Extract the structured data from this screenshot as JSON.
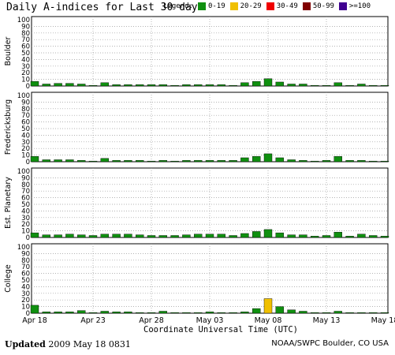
{
  "title": "Daily A-indices for Last 30 days",
  "legend": {
    "title": "Legend:",
    "items": [
      {
        "label": "0-19",
        "color": "#109010"
      },
      {
        "label": "20-29",
        "color": "#f0c000"
      },
      {
        "label": "30-49",
        "color": "#f00000"
      },
      {
        "label": "50-99",
        "color": "#800000"
      },
      {
        "label": ">=100",
        "color": "#400090"
      }
    ]
  },
  "footer": {
    "updated_label": "Updated",
    "updated_value": "2009 May 18 0831",
    "credit": "NOAA/SWPC Boulder, CO USA"
  },
  "chart_data": [
    {
      "type": "bar",
      "ylabel": "Boulder",
      "ylim": [
        0,
        100
      ],
      "yticks": [
        0,
        10,
        20,
        30,
        40,
        50,
        60,
        70,
        80,
        90,
        100
      ],
      "grid": true,
      "categories": [
        "Apr 18",
        "Apr 19",
        "Apr 20",
        "Apr 21",
        "Apr 22",
        "Apr 23",
        "Apr 24",
        "Apr 25",
        "Apr 26",
        "Apr 27",
        "Apr 28",
        "Apr 29",
        "Apr 30",
        "May 01",
        "May 02",
        "May 03",
        "May 04",
        "May 05",
        "May 06",
        "May 07",
        "May 08",
        "May 09",
        "May 10",
        "May 11",
        "May 12",
        "May 13",
        "May 14",
        "May 15",
        "May 16",
        "May 17",
        "May 18"
      ],
      "values": [
        7,
        3,
        4,
        4,
        3,
        1,
        5,
        2,
        2,
        2,
        2,
        2,
        1,
        2,
        2,
        2,
        2,
        1,
        5,
        7,
        11,
        6,
        3,
        3,
        1,
        1,
        5,
        1,
        3,
        1,
        1
      ]
    },
    {
      "type": "bar",
      "ylabel": "Fredericksburg",
      "ylim": [
        0,
        100
      ],
      "yticks": [
        0,
        10,
        20,
        30,
        40,
        50,
        60,
        70,
        80,
        90,
        100
      ],
      "grid": true,
      "categories": [
        "Apr 18",
        "Apr 19",
        "Apr 20",
        "Apr 21",
        "Apr 22",
        "Apr 23",
        "Apr 24",
        "Apr 25",
        "Apr 26",
        "Apr 27",
        "Apr 28",
        "Apr 29",
        "Apr 30",
        "May 01",
        "May 02",
        "May 03",
        "May 04",
        "May 05",
        "May 06",
        "May 07",
        "May 08",
        "May 09",
        "May 10",
        "May 11",
        "May 12",
        "May 13",
        "May 14",
        "May 15",
        "May 16",
        "May 17",
        "May 18"
      ],
      "values": [
        8,
        3,
        3,
        3,
        2,
        1,
        5,
        2,
        2,
        2,
        1,
        2,
        1,
        2,
        2,
        2,
        2,
        2,
        6,
        8,
        12,
        6,
        3,
        2,
        1,
        2,
        8,
        2,
        2,
        1,
        1
      ]
    },
    {
      "type": "bar",
      "ylabel": "Est. Planetary",
      "ylim": [
        0,
        100
      ],
      "yticks": [
        0,
        10,
        20,
        30,
        40,
        50,
        60,
        70,
        80,
        90,
        100
      ],
      "grid": true,
      "categories": [
        "Apr 18",
        "Apr 19",
        "Apr 20",
        "Apr 21",
        "Apr 22",
        "Apr 23",
        "Apr 24",
        "Apr 25",
        "Apr 26",
        "Apr 27",
        "Apr 28",
        "Apr 29",
        "Apr 30",
        "May 01",
        "May 02",
        "May 03",
        "May 04",
        "May 05",
        "May 06",
        "May 07",
        "May 08",
        "May 09",
        "May 10",
        "May 11",
        "May 12",
        "May 13",
        "May 14",
        "May 15",
        "May 16",
        "May 17",
        "May 18"
      ],
      "values": [
        7,
        4,
        4,
        5,
        4,
        3,
        5,
        5,
        5,
        4,
        3,
        3,
        3,
        4,
        5,
        5,
        5,
        3,
        6,
        9,
        12,
        7,
        4,
        4,
        2,
        3,
        8,
        2,
        5,
        3,
        2
      ]
    },
    {
      "type": "bar",
      "ylabel": "College",
      "ylim": [
        0,
        100
      ],
      "yticks": [
        0,
        10,
        20,
        30,
        40,
        50,
        60,
        70,
        80,
        90,
        100
      ],
      "grid": true,
      "categories": [
        "Apr 18",
        "Apr 19",
        "Apr 20",
        "Apr 21",
        "Apr 22",
        "Apr 23",
        "Apr 24",
        "Apr 25",
        "Apr 26",
        "Apr 27",
        "Apr 28",
        "Apr 29",
        "Apr 30",
        "May 01",
        "May 02",
        "May 03",
        "May 04",
        "May 05",
        "May 06",
        "May 07",
        "May 08",
        "May 09",
        "May 10",
        "May 11",
        "May 12",
        "May 13",
        "May 14",
        "May 15",
        "May 16",
        "May 17",
        "May 18"
      ],
      "values": [
        12,
        2,
        2,
        2,
        4,
        1,
        3,
        2,
        2,
        1,
        1,
        3,
        1,
        1,
        1,
        2,
        1,
        1,
        2,
        7,
        22,
        10,
        5,
        3,
        1,
        1,
        3,
        1,
        1,
        1,
        1
      ]
    }
  ],
  "xaxis": {
    "ticks": [
      {
        "label": "Apr 18",
        "index": 0
      },
      {
        "label": "Apr 23",
        "index": 5
      },
      {
        "label": "Apr 28",
        "index": 10
      },
      {
        "label": "May 03",
        "index": 15
      },
      {
        "label": "May 08",
        "index": 20
      },
      {
        "label": "May 13",
        "index": 25
      },
      {
        "label": "May 18",
        "index": 30
      }
    ],
    "label": "Coordinate Universal Time (UTC)"
  }
}
